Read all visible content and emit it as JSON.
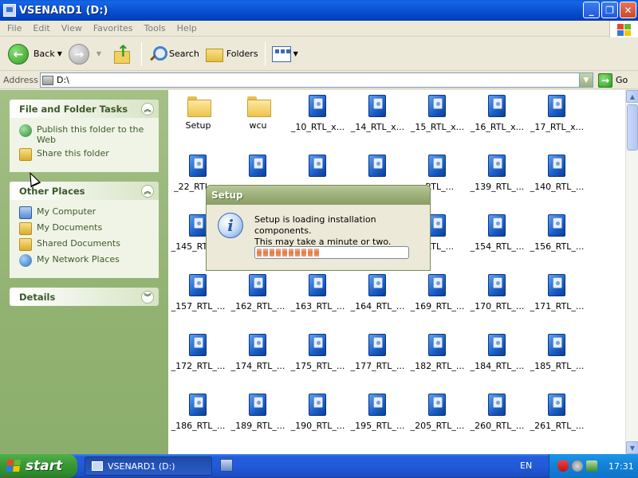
{
  "window": {
    "title": "VSENARD1 (D:)"
  },
  "menu": [
    "File",
    "Edit",
    "View",
    "Favorites",
    "Tools",
    "Help"
  ],
  "toolbar": {
    "back": "Back",
    "search": "Search",
    "folders": "Folders"
  },
  "address": {
    "label": "Address",
    "value": "D:\\",
    "go": "Go"
  },
  "tasks_panel": {
    "title": "File and Folder Tasks",
    "items": [
      "Publish this folder to the Web",
      "Share this folder"
    ]
  },
  "places_panel": {
    "title": "Other Places",
    "items": [
      "My Computer",
      "My Documents",
      "Shared Documents",
      "My Network Places"
    ]
  },
  "details_panel": {
    "title": "Details"
  },
  "files": [
    {
      "label": "Setup",
      "type": "folder"
    },
    {
      "label": "wcu",
      "type": "folder"
    },
    {
      "label": "_10_RTL_x...",
      "type": "setup"
    },
    {
      "label": "_14_RTL_x...",
      "type": "setup"
    },
    {
      "label": "_15_RTL_x...",
      "type": "setup"
    },
    {
      "label": "_16_RTL_x...",
      "type": "setup"
    },
    {
      "label": "_17_RTL_x...",
      "type": "setup"
    },
    {
      "label": "_22_RTL_...",
      "type": "setup"
    },
    {
      "label": "",
      "type": "setup"
    },
    {
      "label": "",
      "type": "setup"
    },
    {
      "label": "",
      "type": "setup"
    },
    {
      "label": "_RTL_...",
      "type": "setup"
    },
    {
      "label": "_139_RTL_...",
      "type": "setup"
    },
    {
      "label": "_140_RTL_...",
      "type": "setup"
    },
    {
      "label": "_145_RTL_...",
      "type": "setup"
    },
    {
      "label": "",
      "type": "setup"
    },
    {
      "label": "",
      "type": "setup"
    },
    {
      "label": "",
      "type": "setup"
    },
    {
      "label": "_RTL_...",
      "type": "setup"
    },
    {
      "label": "_154_RTL_...",
      "type": "setup"
    },
    {
      "label": "_156_RTL_...",
      "type": "setup"
    },
    {
      "label": "_157_RTL_...",
      "type": "setup"
    },
    {
      "label": "_162_RTL_...",
      "type": "setup"
    },
    {
      "label": "_163_RTL_...",
      "type": "setup"
    },
    {
      "label": "_164_RTL_...",
      "type": "setup"
    },
    {
      "label": "_169_RTL_...",
      "type": "setup"
    },
    {
      "label": "_170_RTL_...",
      "type": "setup"
    },
    {
      "label": "_171_RTL_...",
      "type": "setup"
    },
    {
      "label": "_172_RTL_...",
      "type": "setup"
    },
    {
      "label": "_174_RTL_...",
      "type": "setup"
    },
    {
      "label": "_175_RTL_...",
      "type": "setup"
    },
    {
      "label": "_177_RTL_...",
      "type": "setup"
    },
    {
      "label": "_182_RTL_...",
      "type": "setup"
    },
    {
      "label": "_184_RTL_...",
      "type": "setup"
    },
    {
      "label": "_185_RTL_...",
      "type": "setup"
    },
    {
      "label": "_186_RTL_...",
      "type": "setup"
    },
    {
      "label": "_189_RTL_...",
      "type": "setup"
    },
    {
      "label": "_190_RTL_...",
      "type": "setup"
    },
    {
      "label": "_195_RTL_...",
      "type": "setup"
    },
    {
      "label": "_205_RTL_...",
      "type": "setup"
    },
    {
      "label": "_260_RTL_...",
      "type": "setup"
    },
    {
      "label": "_261_RTL_...",
      "type": "setup"
    }
  ],
  "dialog": {
    "title": "Setup",
    "message_line1": "Setup is loading installation components.",
    "message_line2": "This may take a minute or two.",
    "progress": 0.45
  },
  "taskbar": {
    "start": "start",
    "task_window": "VSENARD1 (D:)",
    "language": "EN",
    "clock": "17:31"
  }
}
